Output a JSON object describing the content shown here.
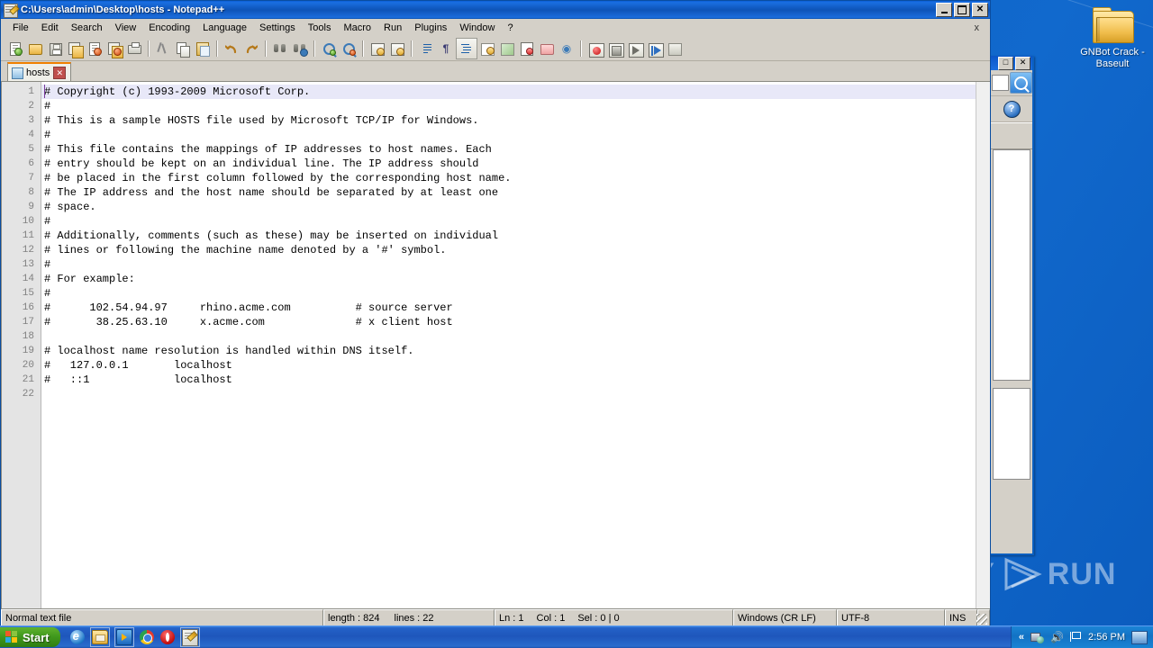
{
  "desktop": {
    "icons": [
      {
        "name": "folder-icon",
        "label": "GNBot Crack - Baseult"
      }
    ]
  },
  "window": {
    "title": "C:\\Users\\admin\\Desktop\\hosts - Notepad++",
    "icon": "notepad-plus-plus-icon",
    "caption_buttons": [
      {
        "name": "minimize-button",
        "label": "_"
      },
      {
        "name": "maximize-button",
        "label": "□"
      },
      {
        "name": "close-button",
        "label": "✕"
      }
    ]
  },
  "menu": {
    "items": [
      "File",
      "Edit",
      "Search",
      "View",
      "Encoding",
      "Language",
      "Settings",
      "Tools",
      "Macro",
      "Run",
      "Plugins",
      "Window",
      "?"
    ],
    "close_document_label": "x"
  },
  "toolbar": {
    "buttons": [
      "new-file-icon",
      "open-file-icon",
      "save-icon",
      "save-all-icon",
      "close-file-icon",
      "close-all-files-icon",
      "print-icon",
      "sep",
      "cut-icon",
      "copy-icon",
      "paste-icon",
      "sep",
      "undo-icon",
      "redo-icon",
      "sep",
      "find-icon",
      "replace-icon",
      "sep",
      "zoom-in-icon",
      "zoom-out-icon",
      "sep",
      "sync-vertical-scrolling-icon",
      "sync-horizontal-scrolling-icon",
      "sep",
      "word-wrap-icon",
      "show-all-characters-icon",
      "sep",
      "indent-guide-icon",
      "user-defined-dialog-icon",
      "show-document-map-icon",
      "function-list-icon",
      "folder-as-workspace-icon",
      "monitoring-icon",
      "sep",
      "start-record-macro-icon",
      "stop-record-macro-icon",
      "playback-macro-icon",
      "run-macro-multiple-icon",
      "save-macro-icon"
    ]
  },
  "tabs": [
    {
      "name": "document-tab-hosts",
      "label": "hosts",
      "icon": "saved-file-icon",
      "close": "✕",
      "active": true
    }
  ],
  "editor": {
    "line_numbers": [
      1,
      2,
      3,
      4,
      5,
      6,
      7,
      8,
      9,
      10,
      11,
      12,
      13,
      14,
      15,
      16,
      17,
      18,
      19,
      20,
      21,
      22
    ],
    "current_line": 1,
    "lines": [
      "# Copyright (c) 1993-2009 Microsoft Corp.",
      "#",
      "# This is a sample HOSTS file used by Microsoft TCP/IP for Windows.",
      "#",
      "# This file contains the mappings of IP addresses to host names. Each",
      "# entry should be kept on an individual line. The IP address should",
      "# be placed in the first column followed by the corresponding host name.",
      "# The IP address and the host name should be separated by at least one",
      "# space.",
      "#",
      "# Additionally, comments (such as these) may be inserted on individual",
      "# lines or following the machine name denoted by a '#' symbol.",
      "#",
      "# For example:",
      "#",
      "#      102.54.94.97     rhino.acme.com          # source server",
      "#       38.25.63.10     x.acme.com              # x client host",
      "",
      "# localhost name resolution is handled within DNS itself.",
      "#   127.0.0.1       localhost",
      "#   ::1             localhost",
      ""
    ]
  },
  "statusbar": {
    "file_type": "Normal text file",
    "length_label": "length : 824",
    "lines_label": "lines : 22",
    "ln_label": "Ln : 1",
    "col_label": "Col : 1",
    "sel_label": "Sel : 0 | 0",
    "eol": "Windows (CR LF)",
    "encoding": "UTF-8",
    "insert_mode": "INS"
  },
  "background_window": {
    "caption_buttons": [
      {
        "name": "maximize-button",
        "label": "□"
      },
      {
        "name": "close-button",
        "label": "✕"
      }
    ],
    "search_icon": "magnifier-icon",
    "help_icon": "help-icon"
  },
  "watermark": {
    "text_left": "ANY",
    "text_right": "RUN",
    "logo": "anyrun-play-logo"
  },
  "taskbar": {
    "start_label": "Start",
    "quick_launch": [
      "internet-explorer-icon",
      "windows-explorer-icon",
      "windows-media-player-icon",
      "chrome-icon",
      "opera-icon",
      "notepad-plus-plus-icon"
    ],
    "tray": {
      "chevron": "«",
      "icons": [
        "network-icon",
        "volume-icon",
        "flag-icon"
      ],
      "clock": "2:56 PM",
      "show_desktop": "show-desktop-icon"
    }
  },
  "colors": {
    "titlebar_blue": "#0e54b8",
    "desktop_blue": "#0d63c8",
    "face": "#d4d0c8",
    "tab_accent": "#f08000",
    "current_line": "#e8e8f8"
  }
}
